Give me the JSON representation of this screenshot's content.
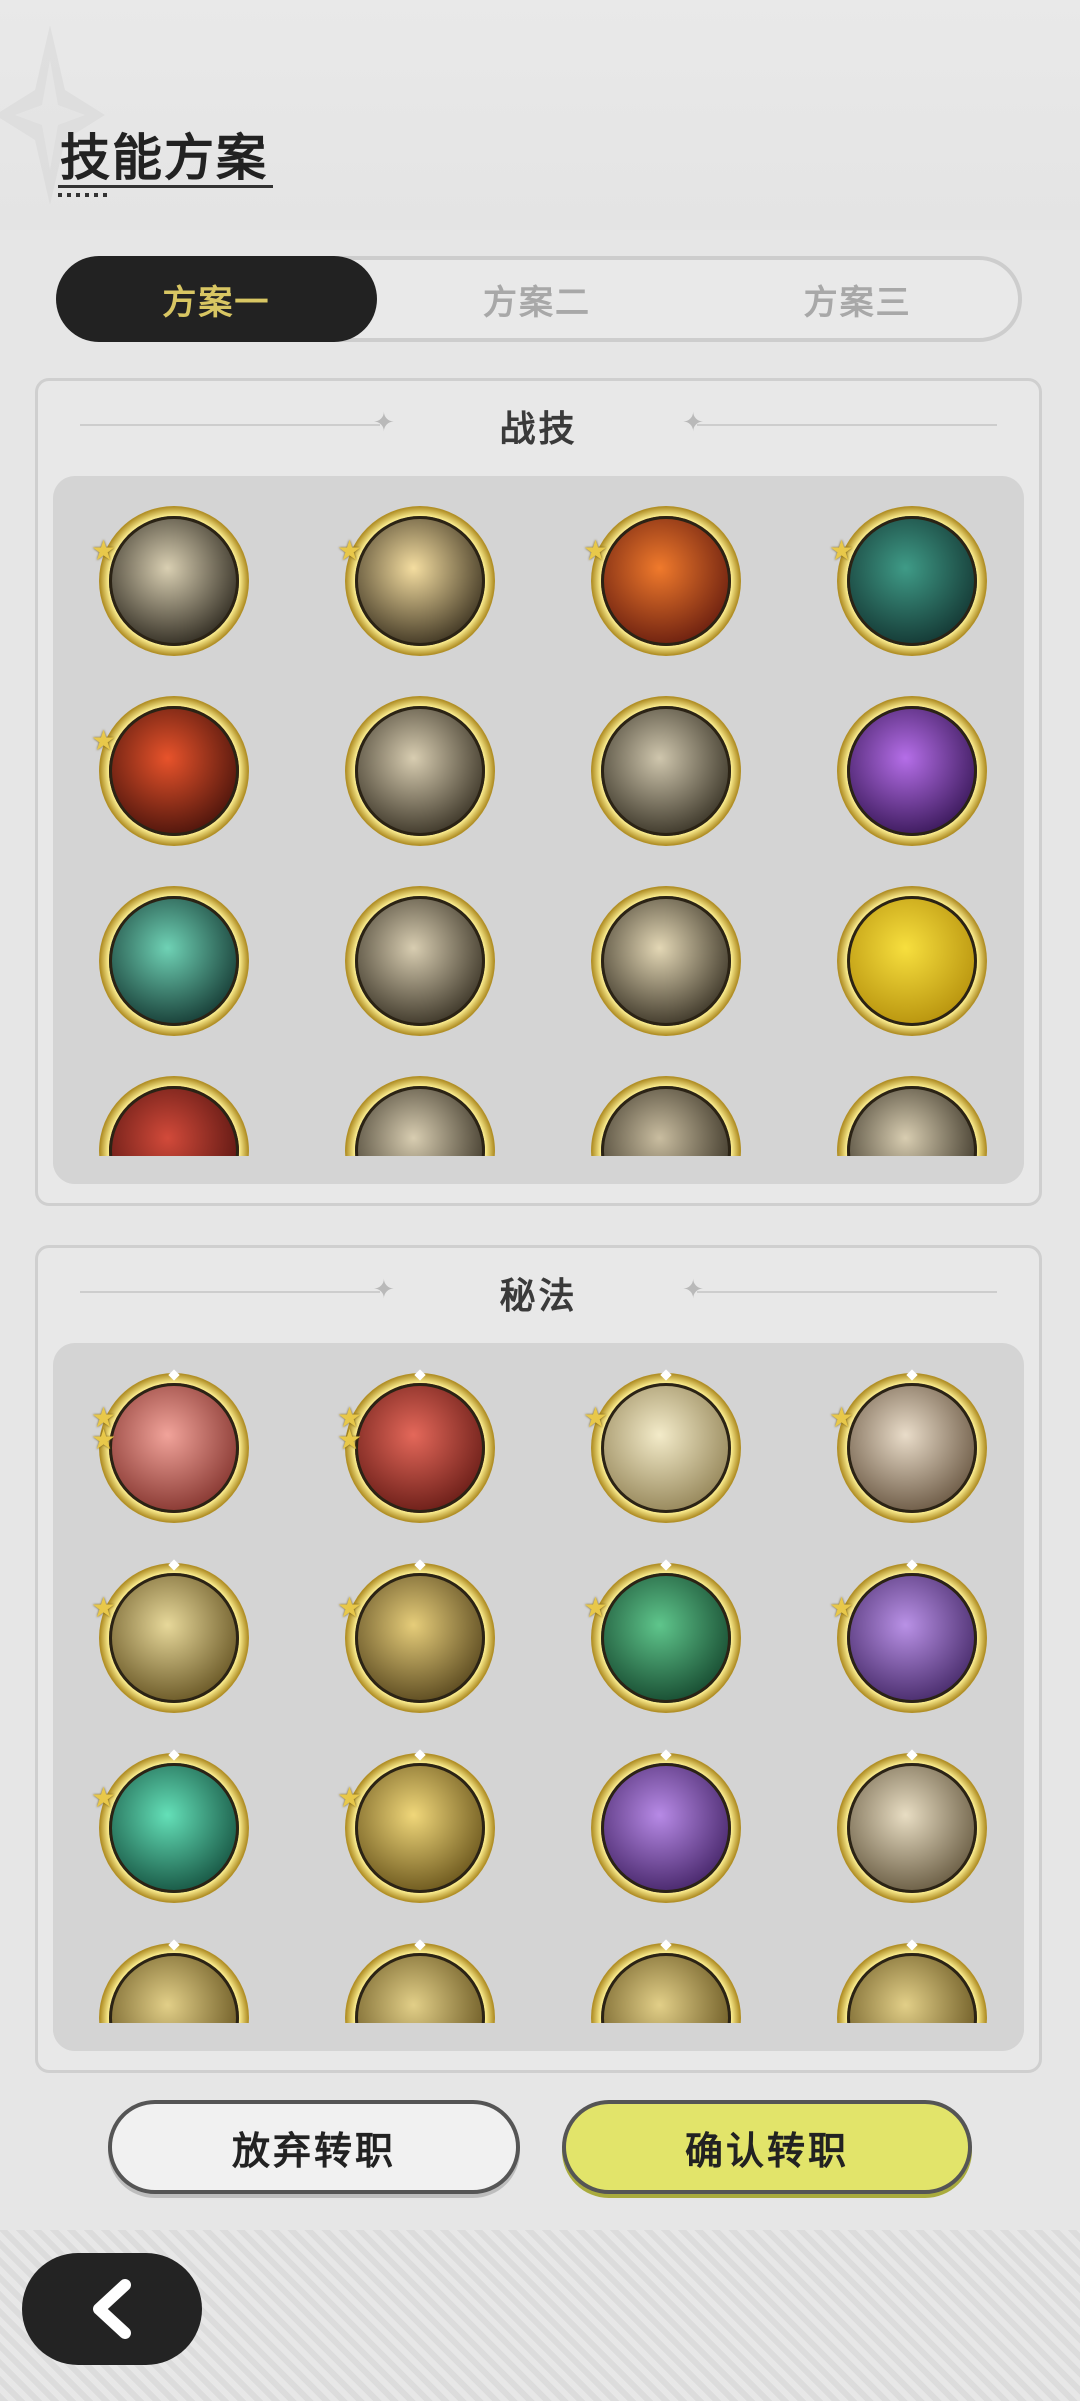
{
  "header": {
    "title": "技能方案"
  },
  "tabs": [
    {
      "label": "方案一",
      "active": true
    },
    {
      "label": "方案二",
      "active": false
    },
    {
      "label": "方案三",
      "active": false
    }
  ],
  "sections": [
    {
      "title": "战技",
      "skills": [
        {
          "icon": "wind-slash-icon",
          "colors": [
            "#d9cfb2",
            "#1e1a12"
          ],
          "stars": 1
        },
        {
          "icon": "burst-icon",
          "colors": [
            "#f4dda0",
            "#2a2214"
          ],
          "stars": 1
        },
        {
          "icon": "flame-rose-icon",
          "colors": [
            "#f07a2c",
            "#5b140c"
          ],
          "stars": 1
        },
        {
          "icon": "web-icon",
          "colors": [
            "#3f9b87",
            "#0f2c2a"
          ],
          "stars": 1
        },
        {
          "icon": "fire-arc-icon",
          "colors": [
            "#e8532b",
            "#3a0d08"
          ],
          "stars": 1
        },
        {
          "icon": "sword-strike-icon",
          "colors": [
            "#d8cdb1",
            "#2a2418"
          ],
          "stars": 0
        },
        {
          "icon": "whirl-icon",
          "colors": [
            "#cfc6ad",
            "#2a2519"
          ],
          "stars": 0
        },
        {
          "icon": "arcane-orb-icon",
          "colors": [
            "#b56ee8",
            "#2c0f4a"
          ],
          "stars": 0
        },
        {
          "icon": "wave-slash-icon",
          "colors": [
            "#6fd2b5",
            "#0c2a26"
          ],
          "stars": 0
        },
        {
          "icon": "spikes-icon",
          "colors": [
            "#d8cdb1",
            "#2a2418"
          ],
          "stars": 0
        },
        {
          "icon": "lightning-slash-icon",
          "colors": [
            "#e3d7b5",
            "#2a2418"
          ],
          "stars": 0
        },
        {
          "icon": "golden-shield-icon",
          "colors": [
            "#f7df3e",
            "#b08a08"
          ],
          "stars": 0
        },
        {
          "icon": "blood-spear-icon",
          "colors": [
            "#d24a3a",
            "#4a0f0c"
          ],
          "stars": 0
        },
        {
          "icon": "orbs-icon",
          "colors": [
            "#d8cdb1",
            "#2a2418"
          ],
          "stars": 0
        },
        {
          "icon": "crescent-icon",
          "colors": [
            "#c9bda0",
            "#2a2418"
          ],
          "stars": 0
        },
        {
          "icon": "claw-icon",
          "colors": [
            "#d8cdb1",
            "#2a2418"
          ],
          "stars": 0
        }
      ]
    },
    {
      "title": "秘法",
      "skills": [
        {
          "icon": "sword-heal-icon",
          "colors": [
            "#f1a39a",
            "#7a2a24"
          ],
          "stars": 2
        },
        {
          "icon": "armor-icon",
          "colors": [
            "#e4685a",
            "#5c1510"
          ],
          "stars": 2
        },
        {
          "icon": "eye-icon",
          "colors": [
            "#f3ebc9",
            "#8a7a4c"
          ],
          "stars": 1
        },
        {
          "icon": "heart-shield-icon",
          "colors": [
            "#e9dcc9",
            "#5d4a35"
          ],
          "stars": 1
        },
        {
          "icon": "target-vortex-icon",
          "colors": [
            "#e7d89a",
            "#5a4818"
          ],
          "stars": 1
        },
        {
          "icon": "golden-armor-icon",
          "colors": [
            "#e6cd7a",
            "#4a3a15"
          ],
          "stars": 1
        },
        {
          "icon": "heart-heal-icon",
          "colors": [
            "#5fc68c",
            "#0f3d26"
          ],
          "stars": 1
        },
        {
          "icon": "panther-icon",
          "colors": [
            "#b991e6",
            "#3a1f5c"
          ],
          "stars": 1
        },
        {
          "icon": "jade-sword-icon",
          "colors": [
            "#64e0b8",
            "#0e4535"
          ],
          "stars": 1
        },
        {
          "icon": "sun-guard-icon",
          "colors": [
            "#f0d77a",
            "#5c4812"
          ],
          "stars": 1
        },
        {
          "icon": "spirit-cage-icon",
          "colors": [
            "#b78ae6",
            "#3a1b5c"
          ],
          "stars": 0
        },
        {
          "icon": "shard-icon",
          "colors": [
            "#e8ddc3",
            "#5a4d34"
          ],
          "stars": 0
        },
        {
          "icon": "guardian-icon",
          "colors": [
            "#e2cf88",
            "#5a4815"
          ],
          "stars": 0
        },
        {
          "icon": "leaf-blade-icon",
          "colors": [
            "#e2cf88",
            "#5a4815"
          ],
          "stars": 0
        },
        {
          "icon": "hammer-icon",
          "colors": [
            "#e2cf88",
            "#5a4815"
          ],
          "stars": 0
        },
        {
          "icon": "sword-rise-icon",
          "colors": [
            "#e2cf88",
            "#5a4815"
          ],
          "stars": 0
        }
      ]
    }
  ],
  "actions": {
    "abandon_label": "放弃转职",
    "confirm_label": "确认转职",
    "back_icon": "back-arrow-icon"
  }
}
